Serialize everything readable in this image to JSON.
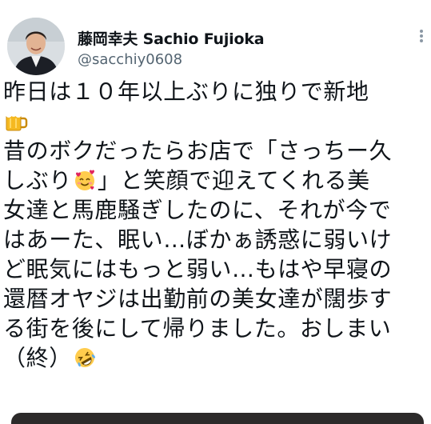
{
  "author": {
    "display_name": "藤岡幸夫 Sachio Fujioka",
    "handle": "@sacchiy0608"
  },
  "tweet": {
    "lines": [
      "昨日は１０年以上ぶりに独りで新地",
      "",
      "昔のボクだったらお店で「さっちー久",
      "しぶり",
      "女達と馬鹿騒ぎしたのに、それが今で",
      "はあーた、眠い…ぼかぁ誘惑に弱いけ",
      "ど眠気にはもっと弱い…もはや早寝の",
      "還暦オヤジは出勤前の美女達が闊歩す",
      "る街を後にして帰りました。おしまい",
      "（終）"
    ],
    "line4_tail": "」と笑顔で迎えてくれる美"
  },
  "icons": {
    "more": "more-options-icon",
    "beer": "beer-mug-emoji",
    "smiling_hearts": "smiling-face-with-hearts-emoji",
    "rolling_laughing": "rolling-on-floor-laughing-emoji"
  },
  "colors": {
    "text": "#0f1419",
    "secondary": "#536471",
    "icon": "#8b98a5"
  }
}
